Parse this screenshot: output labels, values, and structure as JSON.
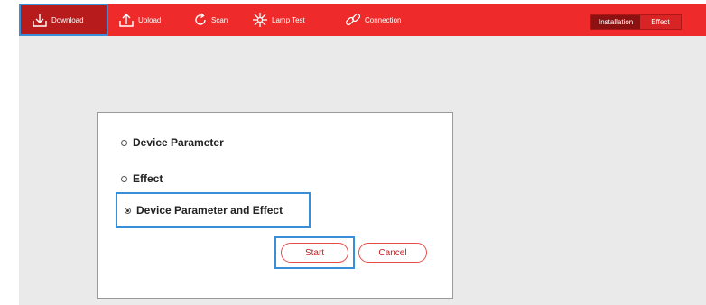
{
  "toolbar": {
    "buttons": [
      {
        "label": "Download",
        "icon": "download-icon"
      },
      {
        "label": "Upload",
        "icon": "upload-icon"
      },
      {
        "label": "Scan",
        "icon": "scan-icon"
      },
      {
        "label": "Lamp Test",
        "icon": "lamp-icon"
      },
      {
        "label": "Connection",
        "icon": "link-icon"
      }
    ],
    "active": "Download",
    "modes": [
      "Installation",
      "Effect"
    ],
    "selected_mode": "Installation"
  },
  "dialog": {
    "options": [
      {
        "label": "Device Parameter",
        "checked": false
      },
      {
        "label": "Effect",
        "checked": false
      },
      {
        "label": "Device Parameter and Effect",
        "checked": true
      }
    ],
    "start_label": "Start",
    "cancel_label": "Cancel"
  },
  "colors": {
    "toolbar": "#ee2a2a",
    "highlight": "#3a8ed8",
    "workspace": "#eaeaea"
  }
}
